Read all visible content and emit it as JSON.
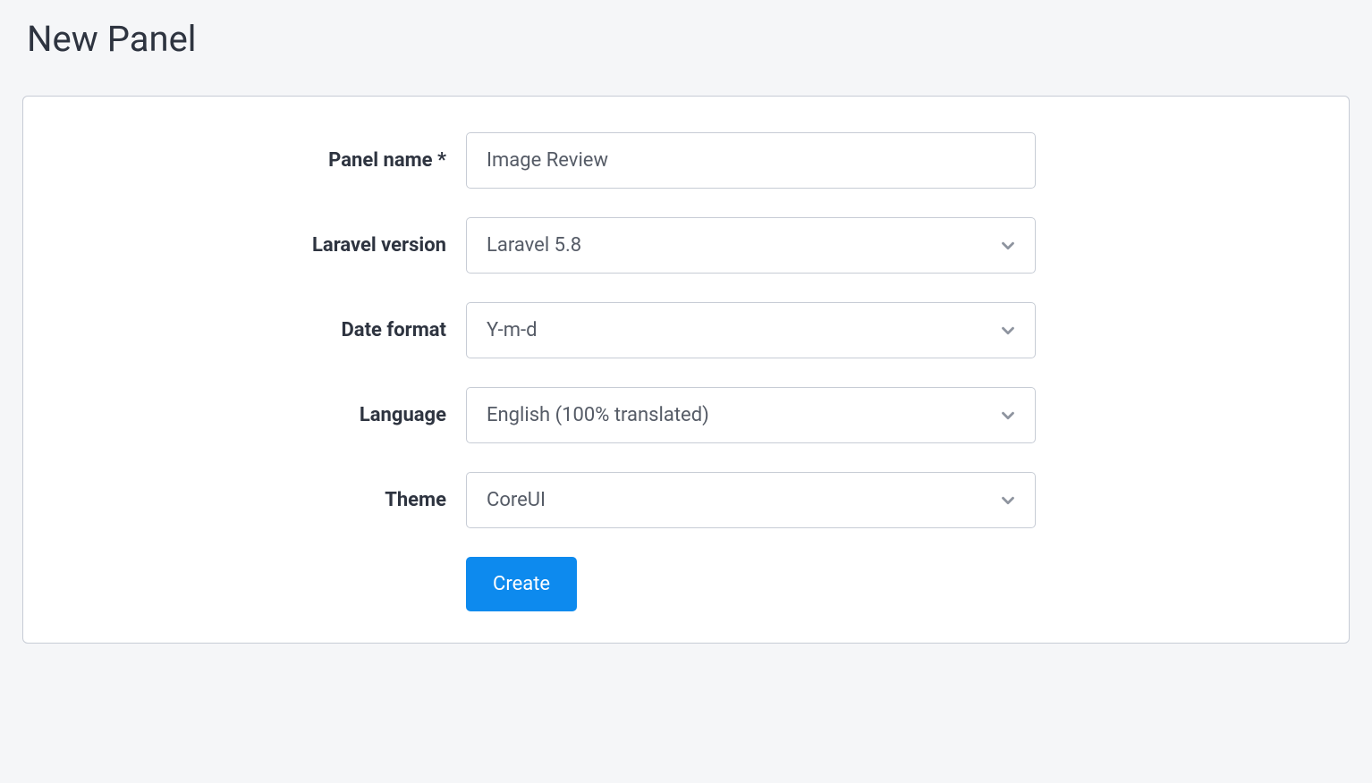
{
  "page": {
    "title": "New Panel"
  },
  "form": {
    "panel_name": {
      "label": "Panel name *",
      "value": "Image Review"
    },
    "laravel_version": {
      "label": "Laravel version",
      "value": "Laravel 5.8"
    },
    "date_format": {
      "label": "Date format",
      "value": "Y-m-d"
    },
    "language": {
      "label": "Language",
      "value": "English (100% translated)"
    },
    "theme": {
      "label": "Theme",
      "value": "CoreUI"
    },
    "submit_label": "Create"
  }
}
